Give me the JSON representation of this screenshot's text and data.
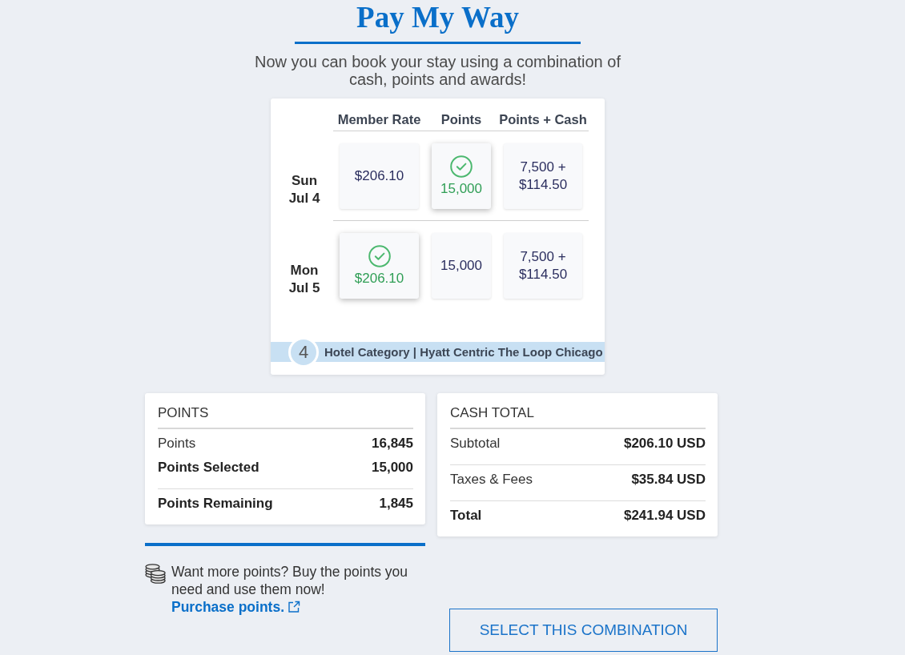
{
  "header": {
    "title": "Pay My Way",
    "subtitle": "Now you can book your stay using a combination of cash, points and awards!"
  },
  "rates": {
    "columns": [
      "Member Rate",
      "Points",
      "Points + Cash"
    ],
    "rows": [
      {
        "day": "Sun",
        "date": "Jul 4",
        "options": [
          {
            "value": "$206.10",
            "selected": false
          },
          {
            "value": "15,000",
            "selected": true
          },
          {
            "value": "7,500 + $114.50",
            "selected": false
          }
        ]
      },
      {
        "day": "Mon",
        "date": "Jul 5",
        "options": [
          {
            "value": "$206.10",
            "selected": true
          },
          {
            "value": "15,000",
            "selected": false
          },
          {
            "value": "7,500 + $114.50",
            "selected": false
          }
        ]
      }
    ],
    "hotel": {
      "category": "4",
      "label": "Hotel Category | Hyatt Centric The Loop Chicago"
    }
  },
  "points_summary": {
    "title": "POINTS",
    "sections": [
      {
        "rows": [
          {
            "label": "Points",
            "value": "16,845",
            "bold": false
          },
          {
            "label": "Points Selected",
            "value": "15,000",
            "bold": true
          }
        ]
      },
      {
        "rows": [
          {
            "label": "Points Remaining",
            "value": "1,845",
            "bold": true
          }
        ]
      }
    ]
  },
  "cash_summary": {
    "title": "CASH TOTAL",
    "sections": [
      {
        "rows": [
          {
            "label": "Subtotal",
            "value": "$206.10 USD",
            "bold": false
          }
        ]
      },
      {
        "rows": [
          {
            "label": "Taxes & Fees",
            "value": "$35.84 USD",
            "bold": false
          }
        ]
      },
      {
        "rows": [
          {
            "label": "Total",
            "value": "$241.94 USD",
            "bold": true
          }
        ]
      }
    ]
  },
  "promo": {
    "text": "Want more points? Buy the points you need and use them now!",
    "link": "Purchase points."
  },
  "select_button": {
    "label": "SELECT THIS COMBINATION"
  }
}
